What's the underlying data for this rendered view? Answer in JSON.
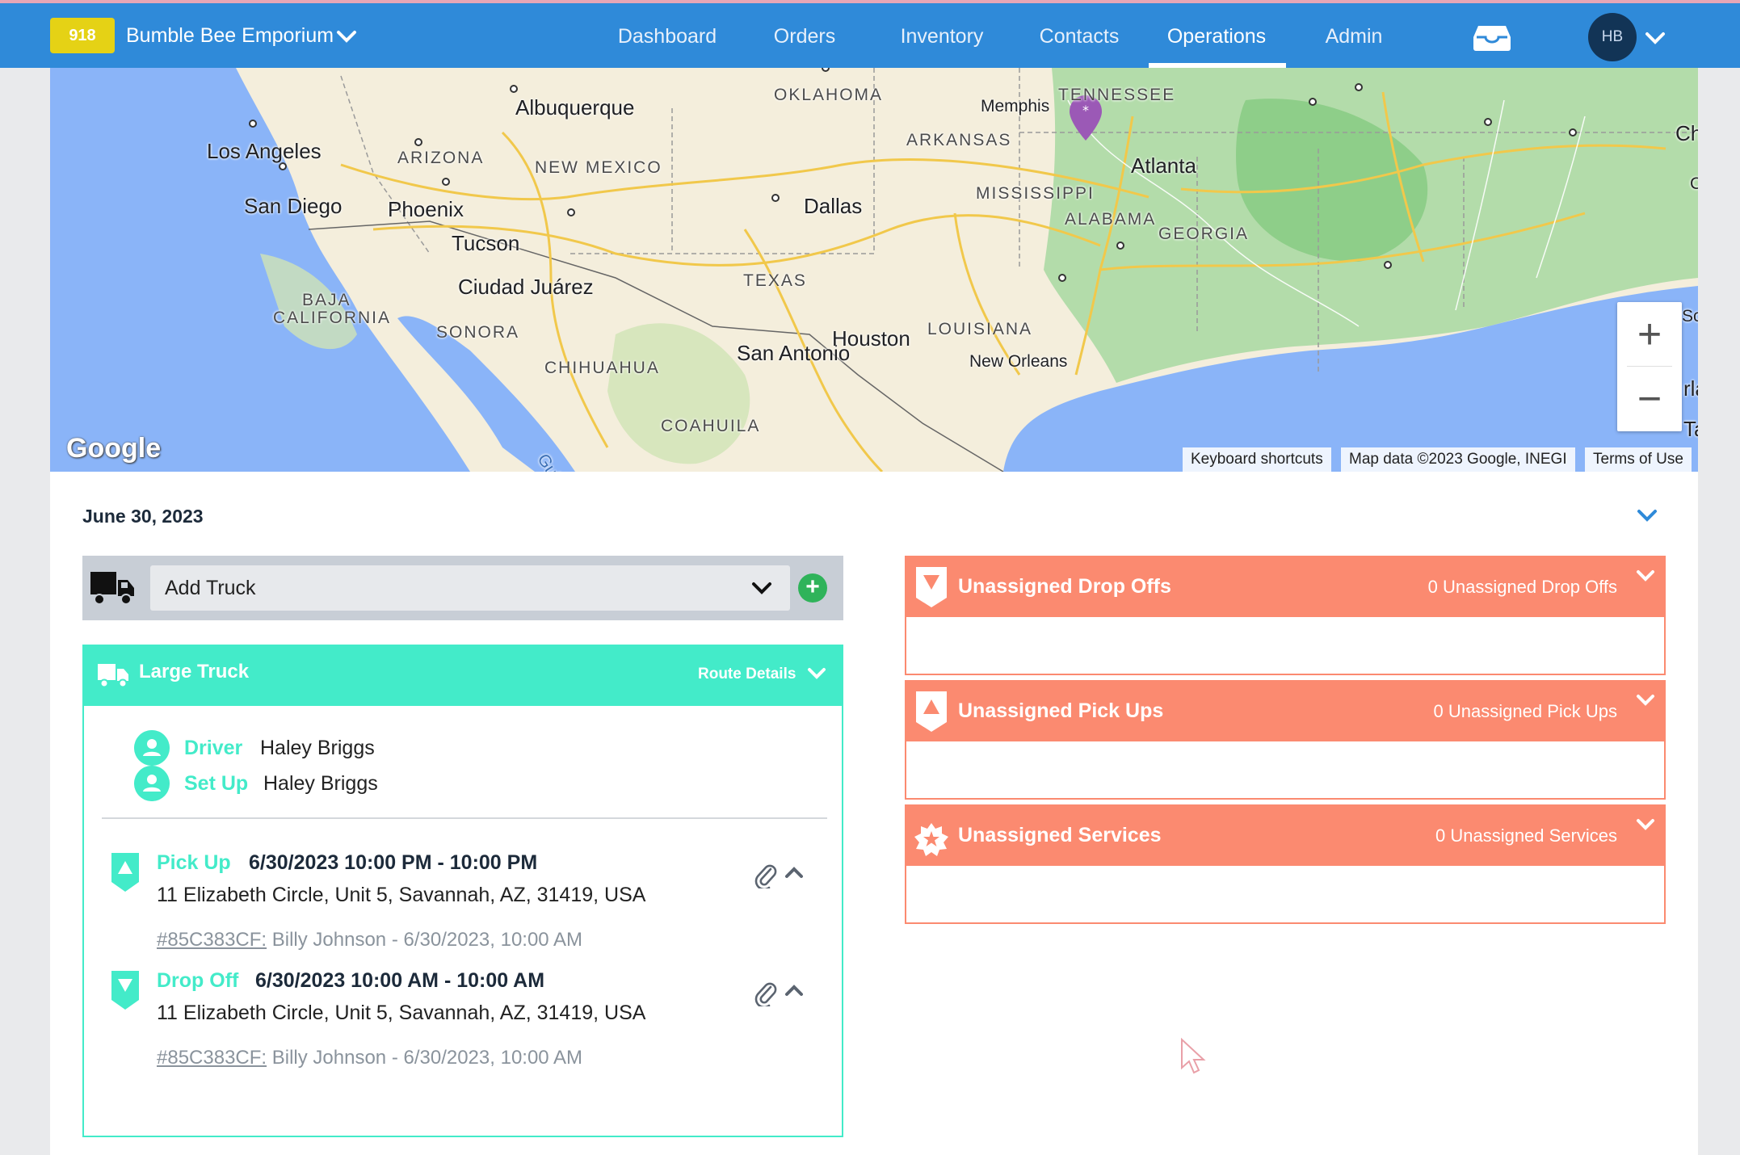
{
  "header": {
    "account_badge": "918",
    "account_name": "Bumble Bee Emporium",
    "nav": [
      {
        "label": "Dashboard",
        "active": false
      },
      {
        "label": "Orders",
        "active": false
      },
      {
        "label": "Inventory",
        "active": false
      },
      {
        "label": "Contacts",
        "active": false
      },
      {
        "label": "Operations",
        "active": true
      },
      {
        "label": "Admin",
        "active": false
      }
    ],
    "inbox_icon": "inbox-icon",
    "avatar_initials": "HB",
    "colors": {
      "bar": "#2f8ad9",
      "badge": "#e5d215"
    }
  },
  "map": {
    "cities": [
      "Los Angeles",
      "San Diego",
      "Phoenix",
      "Tucson",
      "Albuquerque",
      "Ciudad Juárez",
      "Dallas",
      "San Antonio",
      "Houston",
      "Memphis",
      "Atlanta",
      "New Orleans"
    ],
    "states": [
      "ARIZONA",
      "NEW MEXICO",
      "OKLAHOMA",
      "ARKANSAS",
      "TENNESSEE",
      "MISSISSIPPI",
      "ALABAMA",
      "GEORGIA",
      "TEXAS",
      "LOUISIANA",
      "BAJA",
      "CALIFORNIA",
      "SONORA",
      "CHIHUAHUA",
      "COAHUILA"
    ],
    "edge_fragments": [
      "Ch",
      "C",
      "Sc",
      "rla",
      "Tar"
    ],
    "gulf_label": "Gulf of Ca",
    "logo": "Google",
    "zoom_in": "+",
    "zoom_out": "−",
    "attribution": [
      "Keyboard shortcuts",
      "Map data ©2023 Google, INEGI",
      "Terms of Use"
    ],
    "marker_color": "#9b59b6"
  },
  "date": "June 30, 2023",
  "add_truck": {
    "label": "Add Truck",
    "add_icon": "+"
  },
  "route": {
    "title": "Large Truck",
    "details_label": "Route Details",
    "people": [
      {
        "role": "Driver",
        "name": "Haley Briggs"
      },
      {
        "role": "Set Up",
        "name": "Haley Briggs"
      }
    ],
    "stops": [
      {
        "type": "Pick Up",
        "time": "6/30/2023  10:00 PM - 10:00 PM",
        "address": "11 Elizabeth Circle, Unit 5, Savannah, AZ, 31419, USA",
        "ref": "#85C383CF:",
        "ref_detail": " Billy Johnson - 6/30/2023, 10:00 AM"
      },
      {
        "type": "Drop Off",
        "time": "6/30/2023  10:00 AM - 10:00 AM",
        "address": "11 Elizabeth Circle, Unit 5, Savannah, AZ, 31419, USA",
        "ref": "#85C383CF:",
        "ref_detail": " Billy Johnson - 6/30/2023, 10:00 AM"
      }
    ],
    "accent_color": "#43ebc9"
  },
  "unassigned": [
    {
      "title": "Unassigned Drop Offs",
      "count": "0 Unassigned Drop Offs",
      "icon": "drop-off-icon"
    },
    {
      "title": "Unassigned Pick Ups",
      "count": "0 Unassigned Pick Ups",
      "icon": "pick-up-icon"
    },
    {
      "title": "Unassigned Services",
      "count": "0 Unassigned Services",
      "icon": "service-star-icon"
    }
  ],
  "unassigned_color": "#fb8a70"
}
